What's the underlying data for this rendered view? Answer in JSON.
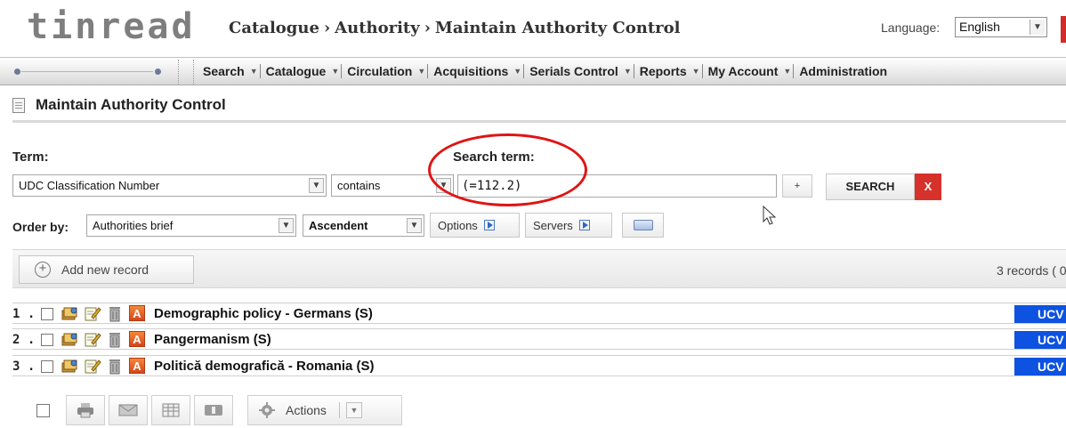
{
  "header": {
    "logo": "tinread",
    "breadcrumb": [
      "Catalogue",
      "Authority",
      "Maintain Authority Control"
    ],
    "breadcrumb_sep": "›",
    "language_label": "Language:",
    "language_value": "English"
  },
  "nav": {
    "items": [
      "Search",
      "Catalogue",
      "Circulation",
      "Acquisitions",
      "Serials Control",
      "Reports",
      "My Account",
      "Administration"
    ]
  },
  "page": {
    "title": "Maintain Authority Control"
  },
  "search": {
    "term_label": "Term:",
    "search_term_label": "Search term:",
    "term_field": "UDC Classification Number",
    "operator": "contains",
    "query": "(=112.2)",
    "plus_label": "+",
    "search_button": "SEARCH",
    "clear_button": "X",
    "order_label": "Order by:",
    "order_field": "Authorities brief",
    "direction": "Ascendent",
    "options_button": "Options",
    "servers_button": "Servers"
  },
  "toolbar": {
    "add_button": "Add new record",
    "records_count": "3 records ( 0"
  },
  "results": [
    {
      "index": "1 .",
      "title": "Demographic policy - Germans (S)",
      "badge": "UCV"
    },
    {
      "index": "2 .",
      "title": "Pangermanism (S)",
      "badge": "UCV"
    },
    {
      "index": "3 .",
      "title": "Politică demografică - Romania (S)",
      "badge": "UCV"
    }
  ],
  "actions": {
    "label": "Actions"
  },
  "icons": {
    "page": "document-icon",
    "add": "plus-circle-icon",
    "record_type": "authority-a-icon",
    "print": "print-icon",
    "email": "mail-icon",
    "export": "table-icon",
    "kbd": "keyboard-icon"
  },
  "colors": {
    "clear_button": "#d6322b",
    "badge": "#0d52e0",
    "highlight_ellipse": "#e01414",
    "authority_icon": "#e25a22"
  }
}
